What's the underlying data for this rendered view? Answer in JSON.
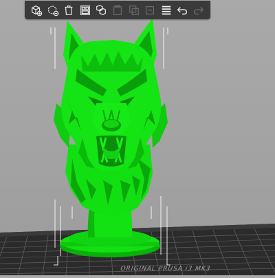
{
  "viewport": {
    "background": "#a5a5a5",
    "model_color": "#11e411",
    "model_shadow": "#079a07",
    "bed_color": "#2a2a2a",
    "bed_grid_color": "#6a6a6a"
  },
  "toolbar": {
    "buttons": [
      {
        "name": "add-object-button",
        "icon": "cube-plus-icon",
        "enabled": true
      },
      {
        "name": "delete-button",
        "icon": "cube-dotted-delete-icon",
        "enabled": true
      },
      {
        "name": "delete-all-button",
        "icon": "trash-icon",
        "enabled": true
      },
      {
        "name": "arrange-button",
        "icon": "arrange-icon",
        "enabled": true
      },
      {
        "name": "copy-button",
        "icon": "copy-icon",
        "enabled": true
      },
      {
        "name": "paste-button",
        "icon": "paste-icon",
        "enabled": false
      },
      {
        "name": "add-instance-button",
        "icon": "instance-plus-icon",
        "enabled": false
      },
      {
        "name": "remove-instance-button",
        "icon": "instance-minus-icon",
        "enabled": false
      },
      {
        "name": "layers-button",
        "icon": "layers-icon",
        "enabled": true
      },
      {
        "name": "undo-button",
        "icon": "undo-icon",
        "enabled": true
      },
      {
        "name": "redo-button",
        "icon": "redo-icon",
        "enabled": false
      }
    ]
  },
  "bed": {
    "label": "ORIGINAL PRUSA i3 MK3"
  }
}
